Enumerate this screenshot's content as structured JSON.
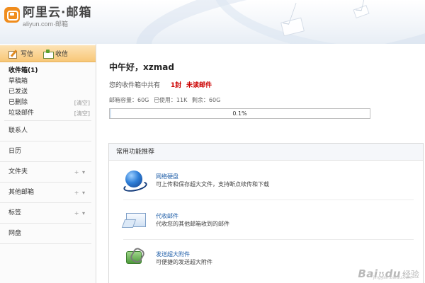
{
  "brand": {
    "name_cn": "阿里云·邮箱",
    "domain": "aliyun.com·邮箱"
  },
  "sidebar": {
    "compose_label": "写信",
    "receive_label": "收信",
    "folders": [
      {
        "label": "收件箱(1)",
        "action": ""
      },
      {
        "label": "草稿箱",
        "action": ""
      },
      {
        "label": "已发送",
        "action": ""
      },
      {
        "label": "已删除",
        "action": "[清空]"
      },
      {
        "label": "垃圾邮件",
        "action": "[清空]"
      }
    ],
    "sections": [
      {
        "label": "联系人",
        "action": ""
      },
      {
        "label": "日历",
        "action": ""
      },
      {
        "label": "文件夹",
        "action": "+ ▾"
      },
      {
        "label": "其他邮箱",
        "action": "+ ▾"
      },
      {
        "label": "标签",
        "action": "+ ▾"
      },
      {
        "label": "网盘",
        "action": ""
      }
    ]
  },
  "main": {
    "greeting": "中午好，xzmad",
    "summary_prefix": "您的收件箱中共有",
    "summary_count": "1封",
    "summary_unread": "未读邮件",
    "storage_total": "邮箱容量：60G",
    "storage_used": "已使用：11K",
    "storage_left": "剩余：60G",
    "progress_label": "0.1%",
    "progress_value": 0.001,
    "recommend_title": "常用功能推荐",
    "recommend_items": [
      {
        "icon": "network-disk-icon",
        "name": "网络硬盘",
        "desc": "可上传和保存超大文件，支持断点续传和下载"
      },
      {
        "icon": "mail-collect-icon",
        "name": "代收邮件",
        "desc": "代收您的其他邮箱收到的邮件"
      },
      {
        "icon": "large-attachment-icon",
        "name": "发送超大附件",
        "desc": "可便捷的发送超大附件"
      }
    ]
  },
  "watermark": {
    "text_main": "Bai",
    "text_paw": "ʊ",
    "text_tail": "du",
    "text_cn": "经验",
    "sub": "jingyan.baidu.com"
  },
  "colors": {
    "accent_orange": "#f8c777",
    "link_blue": "#1f5ea8",
    "alert_red": "#cc0000"
  }
}
